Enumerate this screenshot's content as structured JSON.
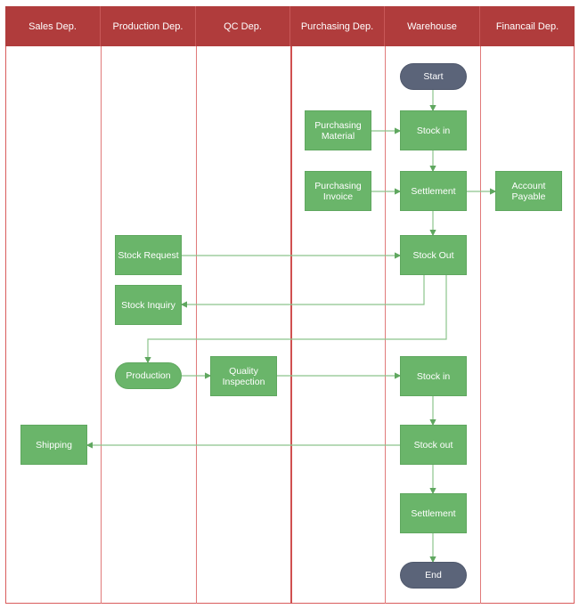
{
  "lanes": [
    "Sales Dep.",
    "Production Dep.",
    "QC Dep.",
    "Purchasing Dep.",
    "Warehouse",
    "Financail Dep."
  ],
  "nodes": {
    "start": "Start",
    "stock_in_1": "Stock in",
    "purchasing_material": "Purchasing Material",
    "purchasing_invoice": "Purchasing Invoice",
    "settlement_1": "Settlement",
    "account_payable": "Account Payable",
    "stock_request": "Stock Request",
    "stock_out_1": "Stock Out",
    "stock_inquiry": "Stock Inquiry",
    "production": "Production",
    "quality_inspection": "Quality Inspection",
    "stock_in_2": "Stock in",
    "shipping": "Shipping",
    "stock_out_2": "Stock out",
    "settlement_2": "Settlement",
    "end": "End"
  },
  "colors": {
    "header": "#b03c3c",
    "lane_line": "#e07a7a",
    "process": "#6ab56a",
    "terminal": "#5b6479",
    "connector": "#6ab56a"
  }
}
